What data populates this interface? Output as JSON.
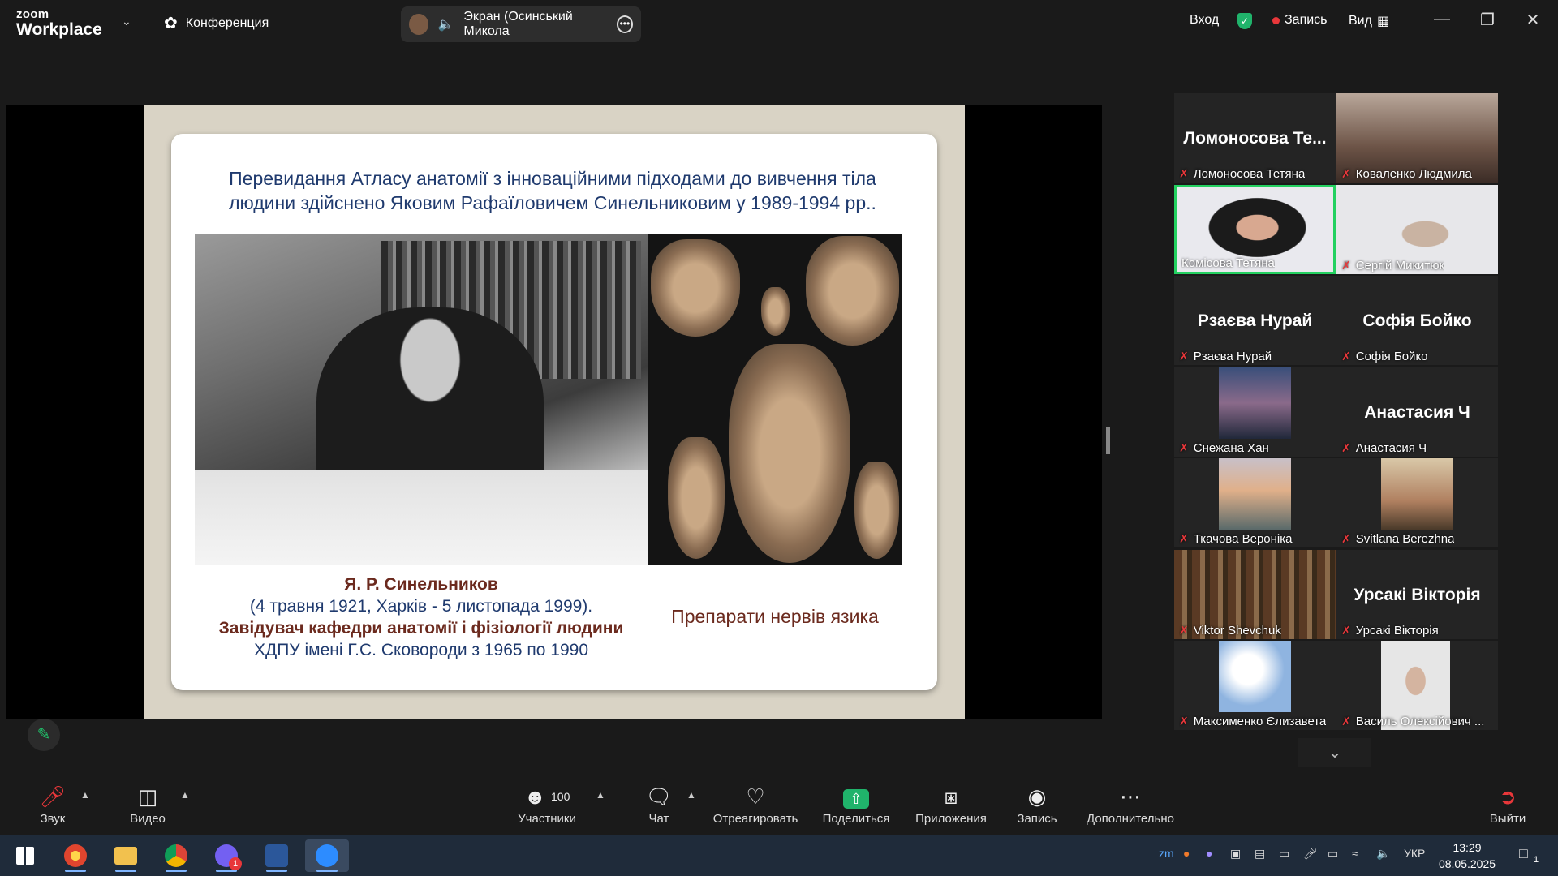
{
  "app": {
    "logo_line1": "zoom",
    "logo_line2": "Workplace"
  },
  "topbar": {
    "conference_label": "Конференция",
    "share_label": "Экран (Осинський Микола",
    "login_label": "Вход",
    "record_label": "Запись",
    "view_label": "Вид"
  },
  "slide": {
    "title_line1": "Перевидання Атласу анатомії з інноваційними підходами до вивчення тіла",
    "title_line2": "людини здійснено Яковим Рафаїловичем Синельниковим у 1989-1994 рр..",
    "caption_name": "Я. Р. Синельников",
    "caption_dates": "(4 травня 1921, Харків - 5 листопада 1999).",
    "caption_role": "Завідувач кафедри анатомії і фізіології людини",
    "caption_university": "ХДПУ імені Г.С. Сковороди з 1965 по 1990",
    "caption_specimens": "Препарати нервів язика"
  },
  "gallery": {
    "tiles": [
      {
        "name": "Ломоносова Тетяна",
        "big": "Ломоносова Те...",
        "video": false
      },
      {
        "name": "Коваленко Людмила",
        "video": true
      },
      {
        "name": "Комісова Тетяна",
        "video": true,
        "active": true
      },
      {
        "name": "Сергій Микитюк",
        "video": true
      },
      {
        "name": "Рзаєва Нурай",
        "big": "Рзаєва Нурай",
        "video": false
      },
      {
        "name": "Софія Бойко",
        "big": "Софія Бойко",
        "video": false
      },
      {
        "name": "Снежана Хан",
        "video": true
      },
      {
        "name": "Анастасия Ч",
        "big": "Анастасия Ч",
        "video": false
      },
      {
        "name": "Ткачова Вероніка",
        "video": true
      },
      {
        "name": "Svitlana Berezhna",
        "video": true
      },
      {
        "name": "Viktor Shevchuk",
        "video": true
      },
      {
        "name": "Урсакі Вікторія",
        "big": "Урсакі Вікторія",
        "video": false
      },
      {
        "name": "Максименко Єлизавета",
        "video": true
      },
      {
        "name": "Василь Олексійович ...",
        "video": true
      }
    ]
  },
  "toolbar": {
    "audio": "Звук",
    "video": "Видео",
    "participants": "Участники",
    "participants_count": "100",
    "chat": "Чат",
    "react": "Отреагировать",
    "share": "Поделиться",
    "apps": "Приложения",
    "record": "Запись",
    "more": "Дополнительно",
    "leave": "Выйти"
  },
  "taskbar": {
    "language": "УКР",
    "time": "13:29",
    "date": "08.05.2025",
    "viber_badge": "1",
    "notif_count": "1"
  },
  "colors": {
    "mute_red": "#e8373a",
    "active_green": "#23d160",
    "share_green": "#20b36b",
    "slide_blue": "#1f3a6e",
    "slide_maroon": "#6b2a1e"
  }
}
